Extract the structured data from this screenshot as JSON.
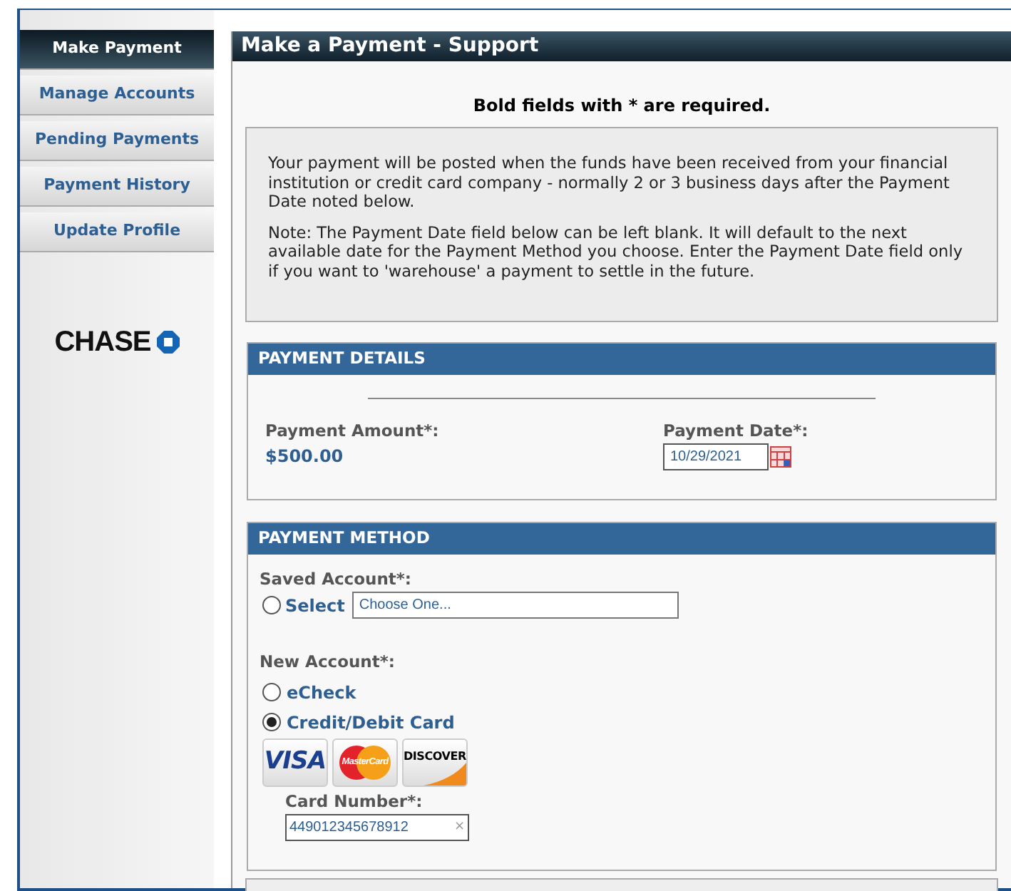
{
  "sidebar": {
    "items": [
      {
        "label": "Make Payment",
        "selected": true
      },
      {
        "label": "Manage Accounts",
        "selected": false
      },
      {
        "label": "Pending Payments",
        "selected": false
      },
      {
        "label": "Payment History",
        "selected": false
      },
      {
        "label": "Update Profile",
        "selected": false
      }
    ]
  },
  "logo": {
    "text": "CHASE"
  },
  "page": {
    "title": "Make a Payment - Support",
    "required_note": "Bold fields with * are required.",
    "notice": [
      "Your payment will be posted when the funds have been received from your financial institution or credit card company - normally 2 or 3 business days after the Payment Date noted below.",
      "Note: The Payment Date field below can be left blank. It will default to the next available date for the Payment Method you choose. Enter the Payment Date field only if you want to 'warehouse' a payment to settle in the future."
    ]
  },
  "payment_details": {
    "title": "PAYMENT DETAILS",
    "amount_label": "Payment Amount*:",
    "amount": "$500.00",
    "date_label": "Payment Date*:",
    "date": "10/29/2021"
  },
  "payment_method": {
    "title": "PAYMENT METHOD",
    "saved_account": {
      "label": "Saved Account*:",
      "option": {
        "label": "Select",
        "selected": false
      },
      "select_value": "Choose One..."
    },
    "new_account": {
      "label": "New Account*:",
      "options": [
        {
          "label": "eCheck",
          "selected": false
        },
        {
          "label": "Credit/Debit Card",
          "selected": true
        }
      ]
    },
    "cards": [
      {
        "kind": "visa",
        "label": "VISA"
      },
      {
        "kind": "mastercard",
        "label": "MasterCard"
      },
      {
        "kind": "discover",
        "label": "DISCOVER"
      }
    ],
    "card_number_label": "Card Number*:",
    "card_number": "449012345678912",
    "clear": "×"
  }
}
